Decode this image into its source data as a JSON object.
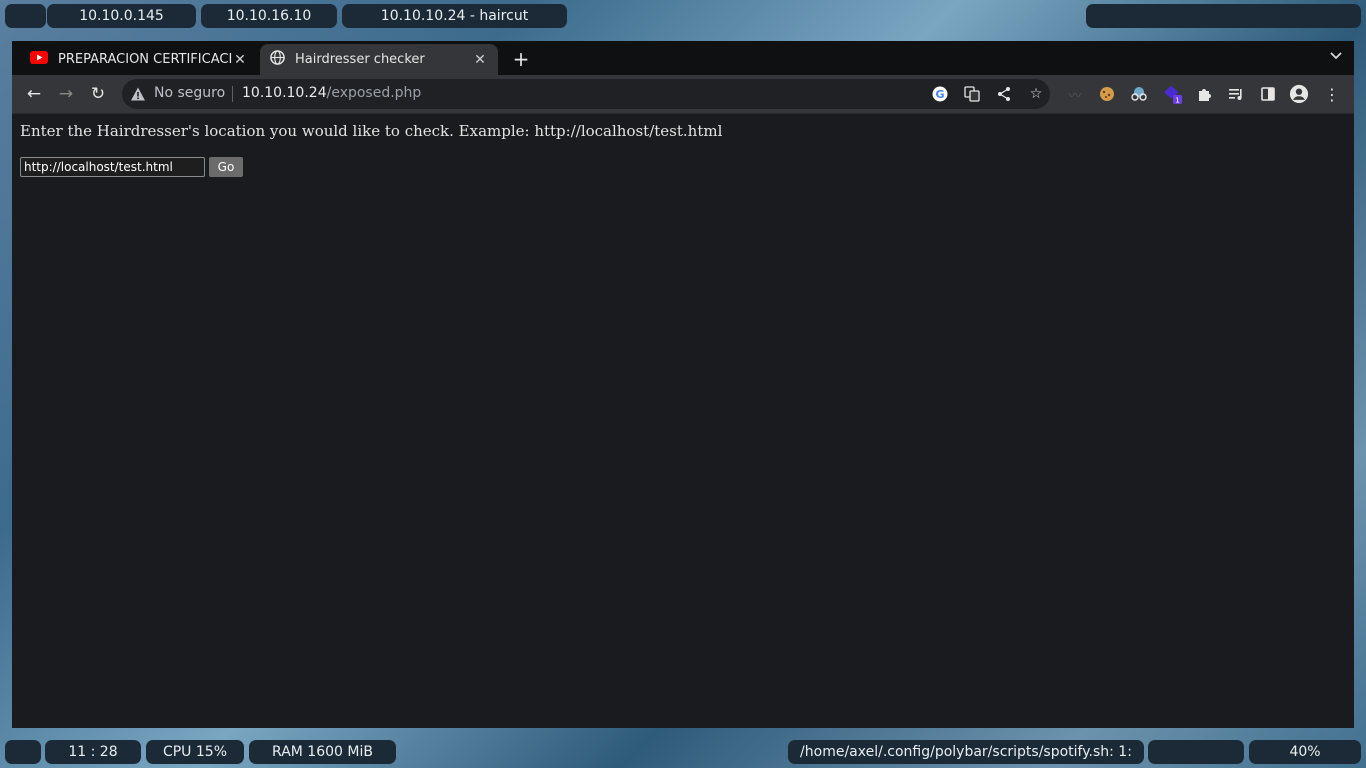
{
  "topbar": {
    "workspaces": [
      "10.10.0.145",
      "10.10.16.10",
      "10.10.10.24 - haircut"
    ],
    "right_module": ""
  },
  "browser": {
    "tabs": [
      {
        "title": "PREPARACIÓN CERTIFICACI",
        "icon": "youtube-icon",
        "active": false
      },
      {
        "title": "Hairdresser checker",
        "icon": "globe-icon",
        "active": true
      }
    ],
    "address": {
      "security_label": "No seguro",
      "host": "10.10.10.24",
      "path": "/exposed.php"
    },
    "extension_badge": "1"
  },
  "page": {
    "prompt": "Enter the Hairdresser's location you would like to check. Example: http://localhost/test.html",
    "input_value": "http://localhost/test.html",
    "go_label": "Go"
  },
  "bottombar": {
    "clock": "11 : 28",
    "cpu": "CPU 15%",
    "ram": "RAM 1600 MiB",
    "spotify": "/home/axel/.config/polybar/scripts/spotify.sh: 1:",
    "battery": "40%"
  },
  "colors": {
    "bar_bg": "#1b2a36",
    "tab_active": "#35363a",
    "page_bg": "#1a1b1e"
  }
}
